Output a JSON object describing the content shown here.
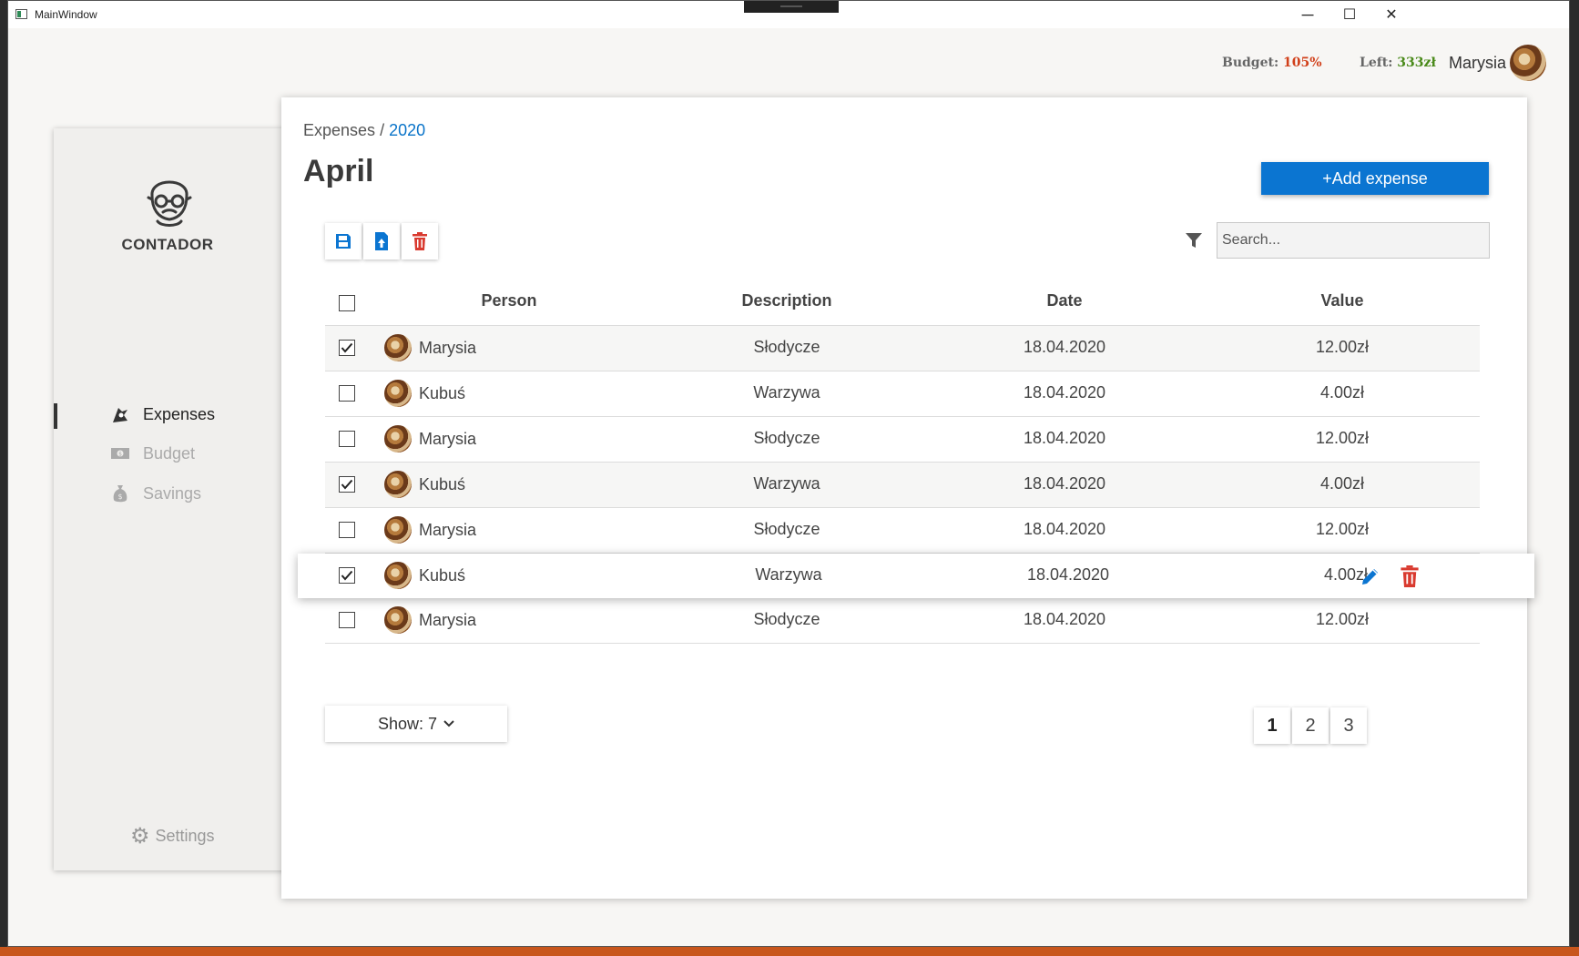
{
  "window": {
    "title": "MainWindow",
    "controls": {
      "minimize": "─",
      "maximize": "☐",
      "close": "✕"
    }
  },
  "header": {
    "budget_label": "Budget:",
    "budget_value": "105%",
    "left_label": "Left:",
    "left_value": "333zł",
    "user_name": "Marysia"
  },
  "sidebar": {
    "brand": "CONTADOR",
    "items": [
      {
        "label": "Expenses",
        "icon": "expenses-icon",
        "active": true
      },
      {
        "label": "Budget",
        "icon": "budget-icon",
        "active": false
      },
      {
        "label": "Savings",
        "icon": "savings-icon",
        "active": false
      }
    ],
    "settings_label": "Settings"
  },
  "main": {
    "breadcrumb_root": "Expenses",
    "breadcrumb_sep": "/",
    "breadcrumb_year": "2020",
    "title": "April",
    "add_button": "+Add expense",
    "search_placeholder": "Search...",
    "toolbar": [
      "save-icon",
      "export-icon",
      "delete-icon"
    ]
  },
  "table": {
    "columns": [
      "Person",
      "Description",
      "Date",
      "Value"
    ],
    "rows": [
      {
        "checked": true,
        "person": "Marysia",
        "description": "Słodycze",
        "date": "18.04.2020",
        "value": "12.00zł"
      },
      {
        "checked": false,
        "person": "Kubuś",
        "description": "Warzywa",
        "date": "18.04.2020",
        "value": "4.00zł"
      },
      {
        "checked": false,
        "person": "Marysia",
        "description": "Słodycze",
        "date": "18.04.2020",
        "value": "12.00zł"
      },
      {
        "checked": true,
        "person": "Kubuś",
        "description": "Warzywa",
        "date": "18.04.2020",
        "value": "4.00zł"
      },
      {
        "checked": false,
        "person": "Marysia",
        "description": "Słodycze",
        "date": "18.04.2020",
        "value": "12.00zł"
      },
      {
        "checked": true,
        "person": "Kubuś",
        "description": "Warzywa",
        "date": "18.04.2020",
        "value": "4.00zł",
        "hovered": true
      },
      {
        "checked": false,
        "person": "Marysia",
        "description": "Słodycze",
        "date": "18.04.2020",
        "value": "12.00zł"
      }
    ]
  },
  "pagination": {
    "show_label": "Show: 7",
    "pages": [
      "1",
      "2",
      "3"
    ],
    "current": "1"
  },
  "colors": {
    "accent": "#0b75d1",
    "danger": "#d93a2f",
    "budget_over": "#d1401a",
    "left_ok": "#4a8a1a"
  }
}
